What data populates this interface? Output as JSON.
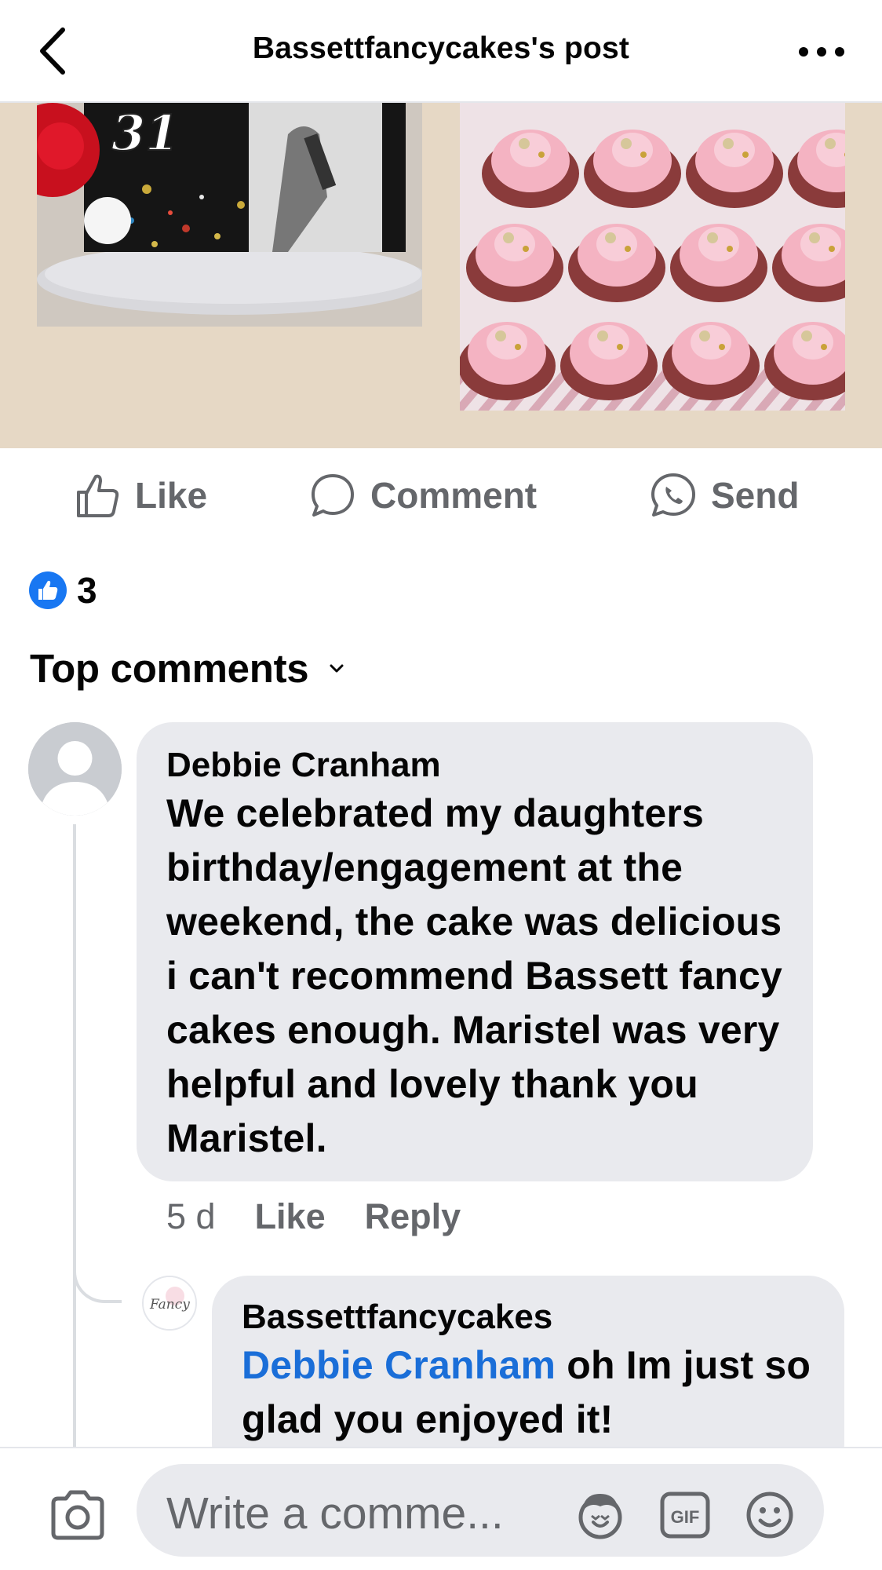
{
  "header": {
    "title": "Bassettfancycakes's post",
    "back_icon": "chevron-left-icon",
    "more_icon": "more-horizontal-icon"
  },
  "post": {
    "cake_number": "31",
    "actions": {
      "like": "Like",
      "comment": "Comment",
      "send": "Send"
    },
    "reaction_count": "3"
  },
  "comments": {
    "section_label": "Top comments",
    "items": [
      {
        "author": "Debbie Cranham",
        "text": "We celebrated my daughters birthday/engagement at the weekend, the cake was delicious i can't recommend Bassett fancy cakes enough. Maristel was very helpful and lovely thank you Maristel.",
        "time": "5 d",
        "like": "Like",
        "reply": "Reply",
        "reply_item": {
          "author": "Bassettfancycakes",
          "mention": "Debbie Cranham",
          "text": "oh Im just so glad you enjoyed it!",
          "avatar_text": "Fancy"
        }
      }
    ]
  },
  "composer": {
    "placeholder": "Write a comme...",
    "gif_label": "GIF"
  },
  "colors": {
    "like_blue": "#1877f2",
    "mention_blue": "#1a6ed8",
    "secondary_text": "#65676b",
    "bubble_bg": "#e9eaee",
    "photo_bg": "#e6d8c5"
  }
}
